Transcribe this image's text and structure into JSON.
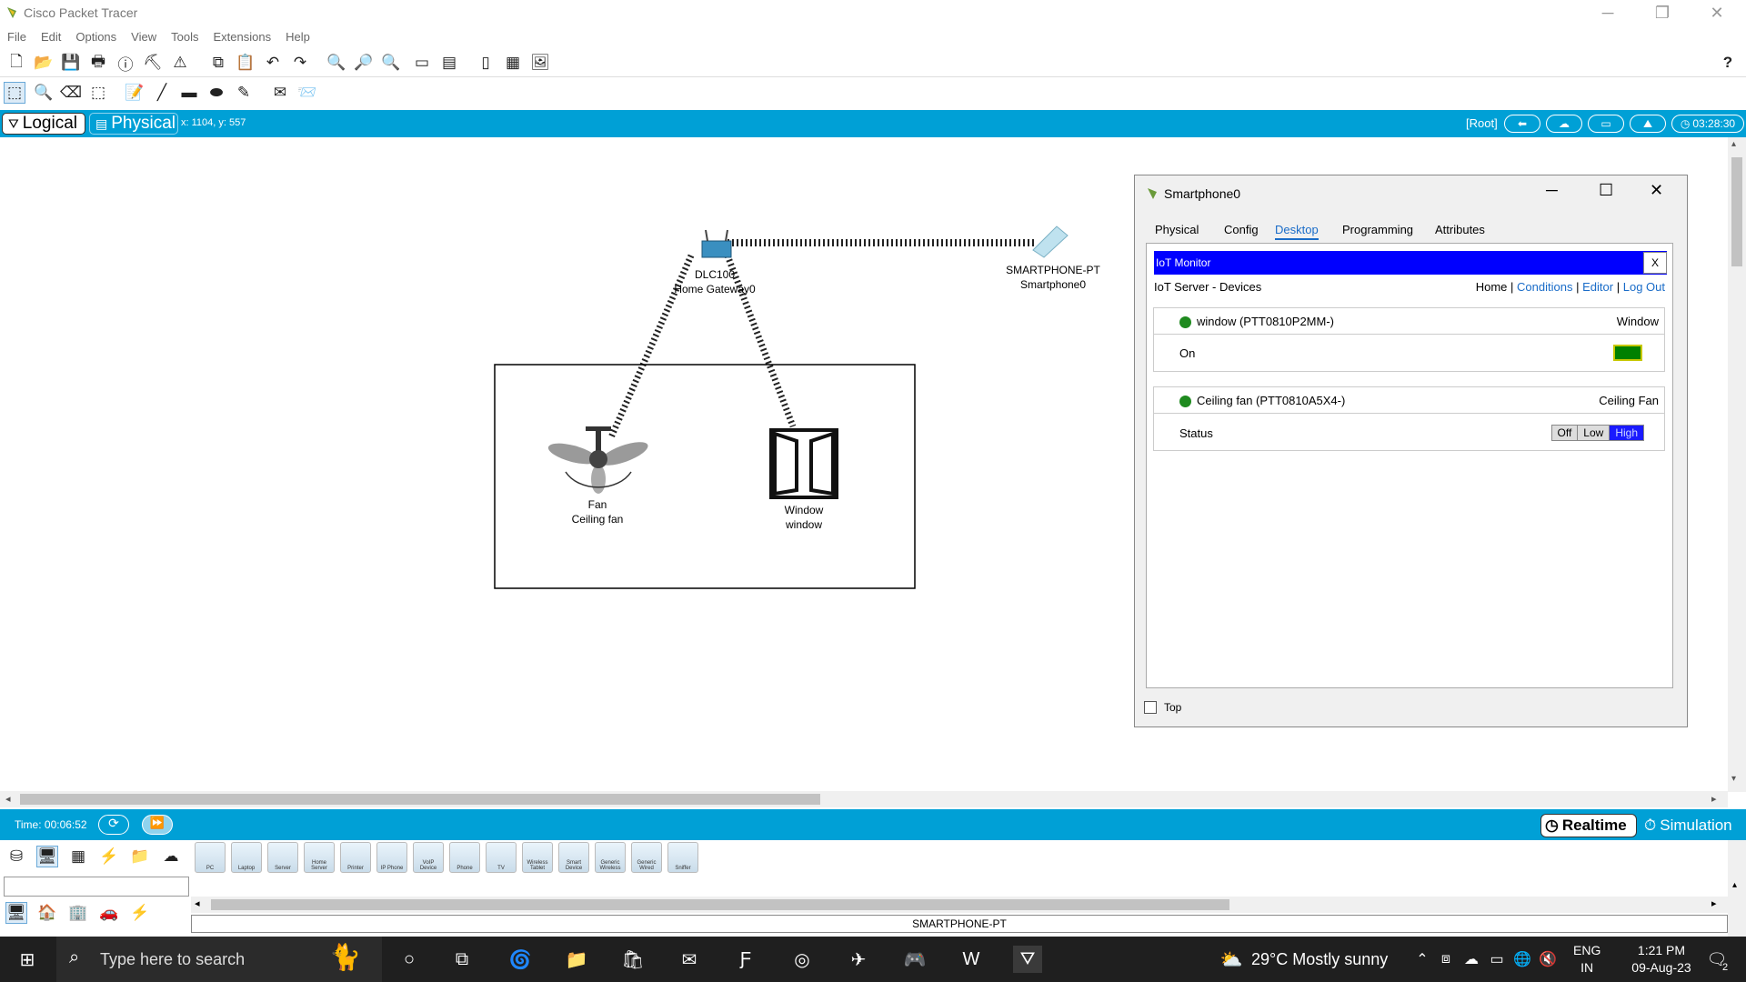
{
  "window": {
    "title": "Cisco Packet Tracer"
  },
  "menu": [
    "File",
    "Edit",
    "Options",
    "View",
    "Tools",
    "Extensions",
    "Help"
  ],
  "toolbar_help": "?",
  "modes": {
    "logical": "Logical",
    "physical": "Physical"
  },
  "cursor_coords": "x: 1104, y: 557",
  "status_right": {
    "root": "[Root]",
    "clock": "03:28:30"
  },
  "devices": {
    "gateway": {
      "line1": "DLC100",
      "line2": "Home Gateway0"
    },
    "smartphone": {
      "line1": "SMARTPHONE-PT",
      "line2": "Smartphone0"
    },
    "fan": {
      "line1": "Fan",
      "line2": "Ceiling fan"
    },
    "window": {
      "line1": "Window",
      "line2": "window"
    }
  },
  "popup": {
    "title": "Smartphone0",
    "tabs": [
      "Physical",
      "Config",
      "Desktop",
      "Programming",
      "Attributes"
    ],
    "active_tab": "Desktop",
    "app_title": "IoT Monitor",
    "app_close": "X",
    "subtitle": "IoT Server - Devices",
    "nav": {
      "home": "Home",
      "conditions": "Conditions",
      "editor": "Editor",
      "logout": "Log Out",
      "sep": "|"
    },
    "items": [
      {
        "name": "window (PTT0810P2MM-)",
        "type": "Window",
        "prop": "On",
        "state_color": "#008000"
      },
      {
        "name": "Ceiling fan (PTT0810A5X4-)",
        "type": "Ceiling Fan",
        "prop": "Status",
        "levels": [
          "Off",
          "Low",
          "High"
        ],
        "active_level": "High"
      }
    ],
    "top_checkbox": "Top"
  },
  "timebar": {
    "time": "Time: 00:06:52",
    "realtime": "Realtime",
    "simulation": "Simulation"
  },
  "palette": {
    "devices": [
      "PC",
      "Laptop",
      "Server",
      "Home Server",
      "Printer",
      "IP Phone",
      "VoIP Device",
      "Phone",
      "TV",
      "Wireless Tablet",
      "Smart Device",
      "Generic Wireless",
      "Generic Wired",
      "Sniffer"
    ],
    "selected_label": "SMARTPHONE-PT"
  },
  "taskbar": {
    "search": "Type here to search",
    "weather": "29°C  Mostly sunny",
    "lang1": "ENG",
    "lang2": "IN",
    "time": "1:21 PM",
    "date": "09-Aug-23",
    "notif": "2"
  },
  "colors": {
    "accent": "#00a0d6",
    "iot_header": "#0000ff",
    "active_level": "#1a1aff"
  }
}
